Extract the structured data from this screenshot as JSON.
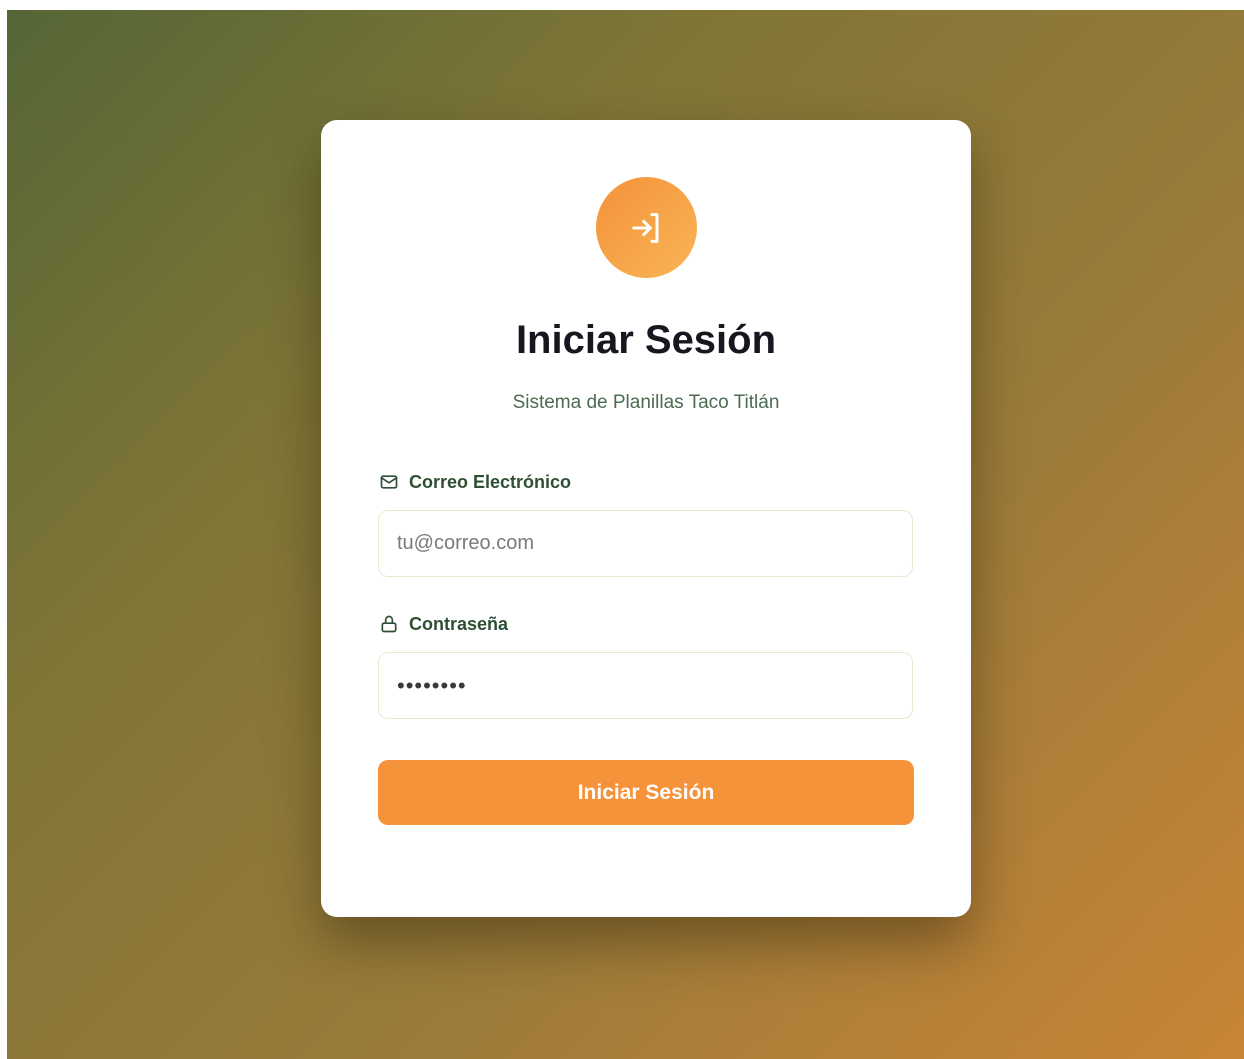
{
  "colors": {
    "accent": "#f5923a",
    "accent_light": "#f8b556",
    "label_green": "#2f4f34",
    "subtitle_green": "#4c6b52",
    "title": "#17171f"
  },
  "login": {
    "icon": "login-arrow-icon",
    "title": "Iniciar Sesión",
    "subtitle": "Sistema de Planillas Taco Titlán",
    "email": {
      "icon": "mail-icon",
      "label": "Correo Electrónico",
      "placeholder": "tu@correo.com",
      "value": ""
    },
    "password": {
      "icon": "lock-icon",
      "label": "Contraseña",
      "value": "••••••••",
      "masked": true
    },
    "submit_label": "Iniciar Sesión"
  }
}
